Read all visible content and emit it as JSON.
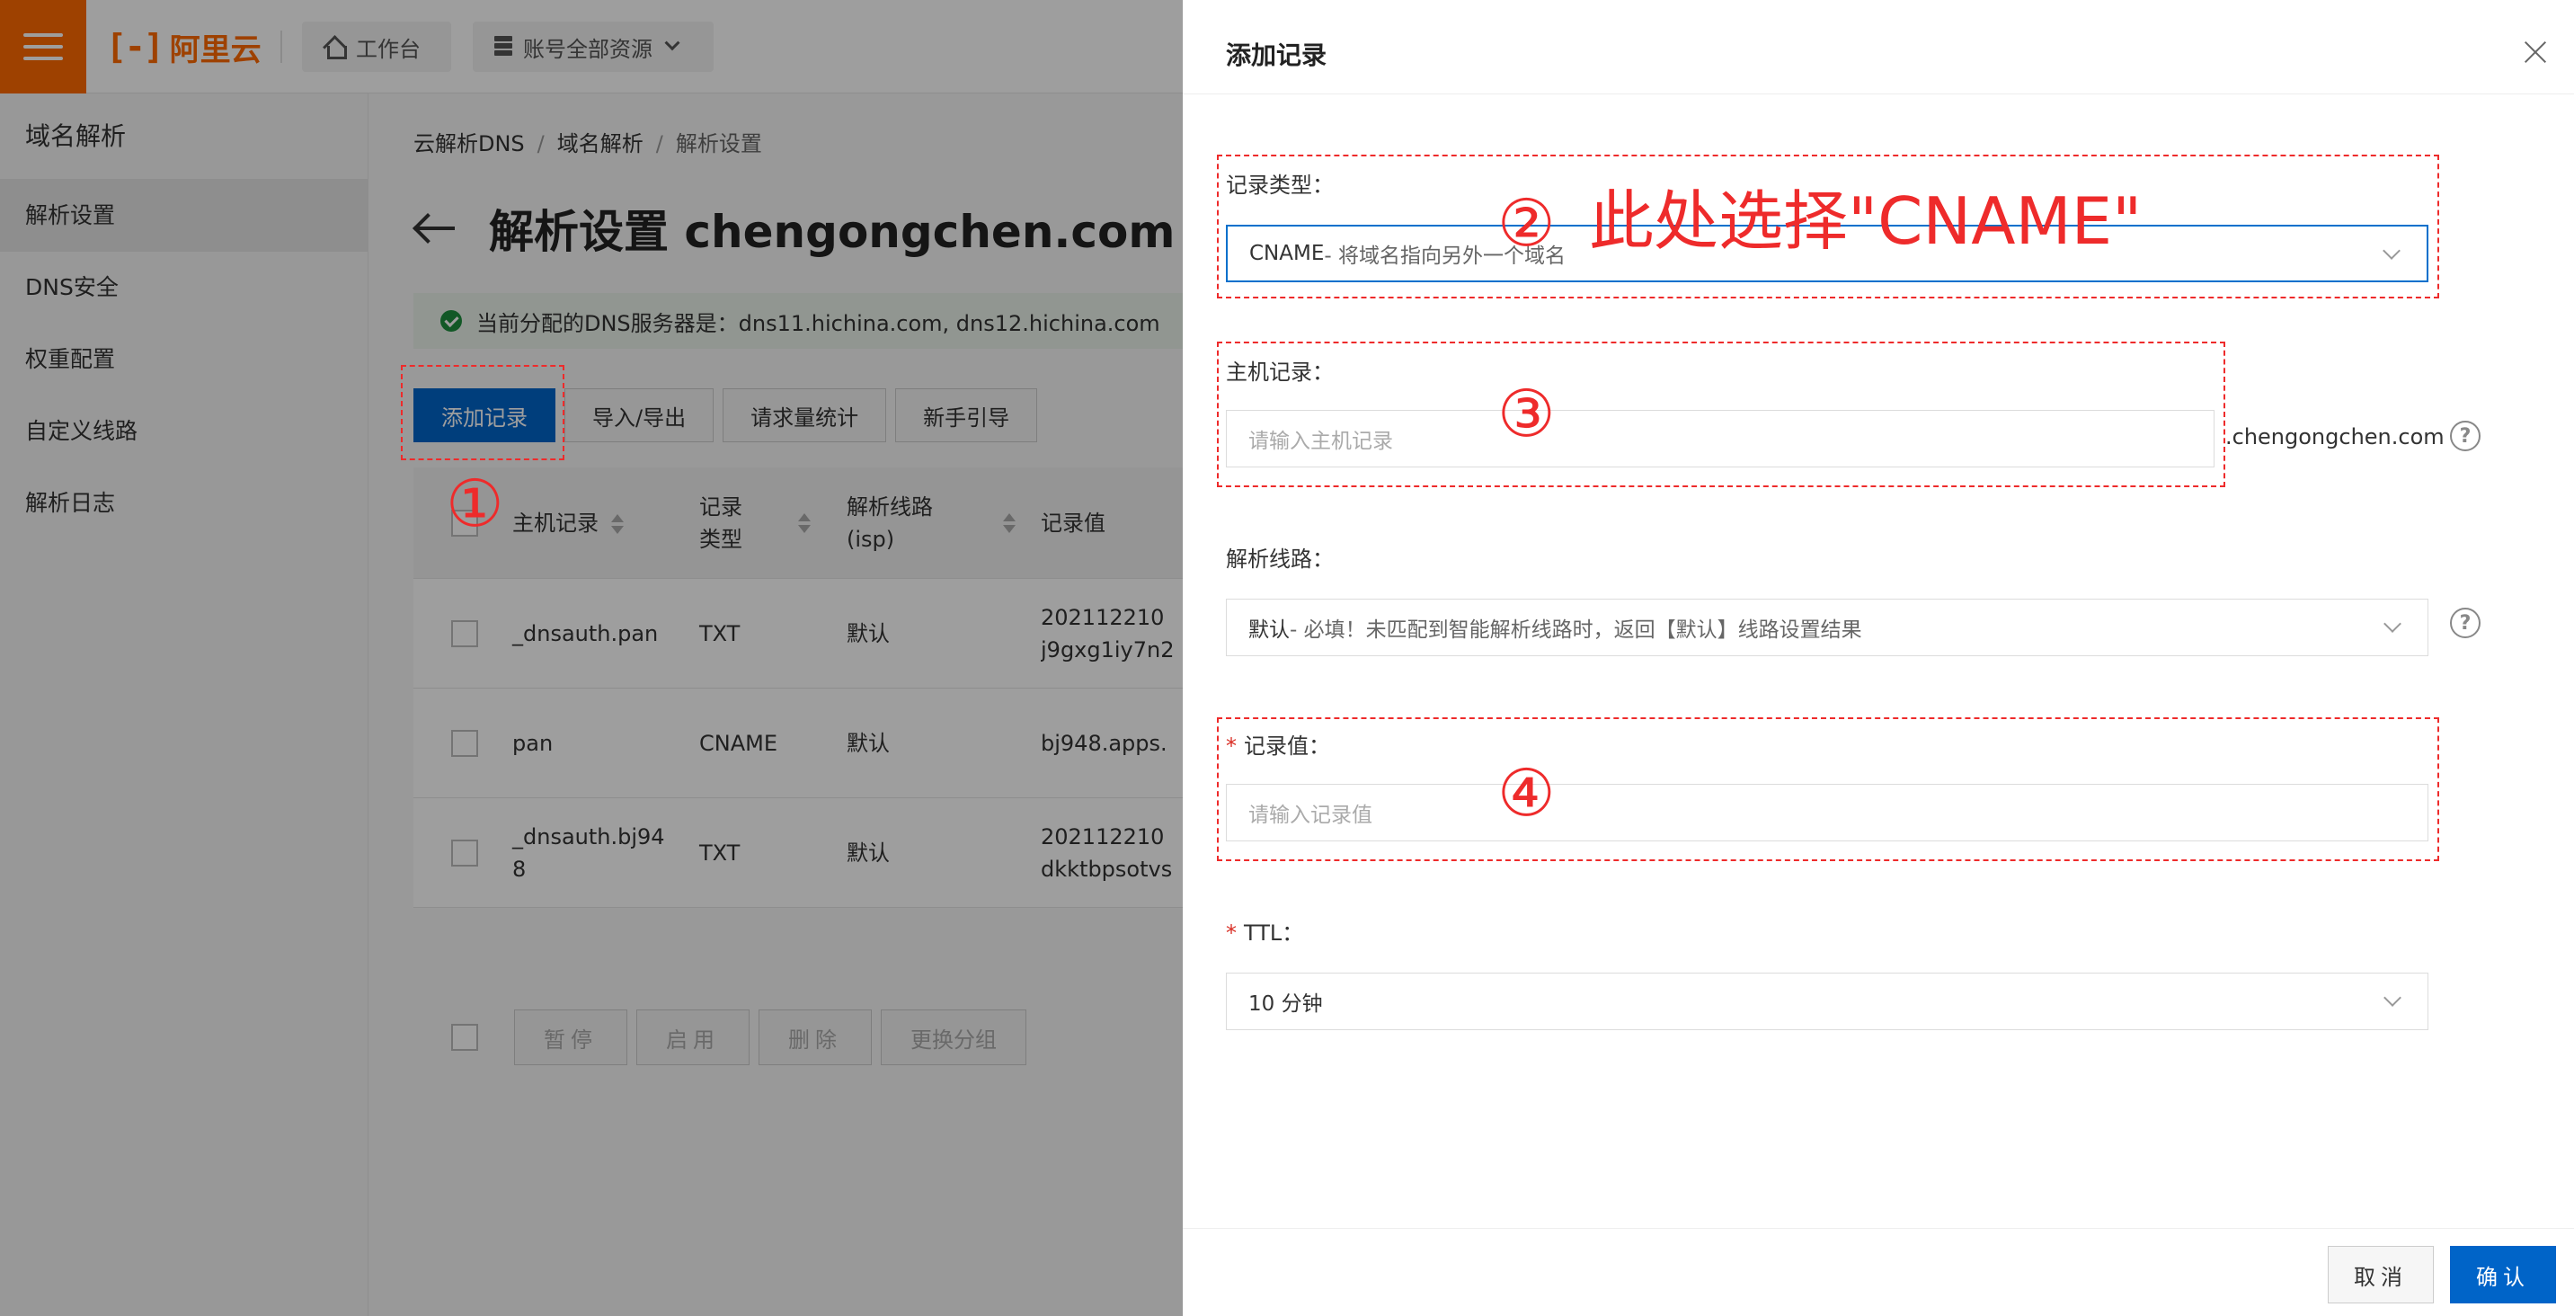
{
  "topbar": {
    "logo_text": "阿里云",
    "logo_mark": "[-]",
    "workbench_label": "工作台",
    "resources_label": "账号全部资源"
  },
  "sidebar": {
    "title": "域名解析",
    "items": [
      {
        "label": "解析设置",
        "active": true
      },
      {
        "label": "DNS安全"
      },
      {
        "label": "权重配置"
      },
      {
        "label": "自定义线路"
      },
      {
        "label": "解析日志"
      }
    ],
    "collapse_glyph": "<"
  },
  "breadcrumb": [
    "云解析DNS",
    "域名解析",
    "解析设置"
  ],
  "breadcrumb_sep": "/",
  "page_title": "解析设置 chengongchen.com",
  "dns_notice": "当前分配的DNS服务器是：dns11.hichina.com, dns12.hichina.com",
  "toolbar": {
    "add_record": "添加记录",
    "import_export": "导入/导出",
    "request_stats": "请求量统计",
    "beginner_guide": "新手引导"
  },
  "table": {
    "headers": {
      "host": "主机记录",
      "type": "记录类型",
      "line": "解析线路(isp)",
      "value": "记录值"
    },
    "rows": [
      {
        "host": "_dnsauth.pan",
        "type": "TXT",
        "line": "默认",
        "value": "202112210\nj9gxg1iy7n2"
      },
      {
        "host": "pan",
        "type": "CNAME",
        "line": "默认",
        "value": "bj948.apps."
      },
      {
        "host": "_dnsauth.bj948",
        "type": "TXT",
        "line": "默认",
        "value": "202112210\ndkktbpsotvs"
      }
    ]
  },
  "batch": {
    "pause": "暂停",
    "enable": "启用",
    "delete": "删除",
    "change_group": "更换分组"
  },
  "drawer": {
    "title": "添加记录",
    "record_type": {
      "label": "记录类型：",
      "value": "CNAME",
      "hint": "- 将域名指向另外一个域名"
    },
    "host_record": {
      "label": "主机记录：",
      "placeholder": "请输入主机记录",
      "suffix": ".chengongchen.com"
    },
    "resolve_line": {
      "label": "解析线路：",
      "value": "默认",
      "hint": " - 必填！未匹配到智能解析线路时，返回【默认】线路设置结果"
    },
    "record_value": {
      "label": "记录值：",
      "placeholder": "请输入记录值",
      "required": "*"
    },
    "ttl": {
      "label": "TTL：",
      "value": "10 分钟",
      "required": "*"
    },
    "help_glyph": "?",
    "cancel": "取消",
    "confirm": "确认"
  },
  "annotations": {
    "step1": "①",
    "step2": "②",
    "step2_text": "此处选择\"CNAME\"",
    "step3": "③",
    "step4": "④",
    "color": "#ee2b2b"
  },
  "colors": {
    "brand_orange": "#ff6a00",
    "primary_blue": "#0064c8"
  }
}
